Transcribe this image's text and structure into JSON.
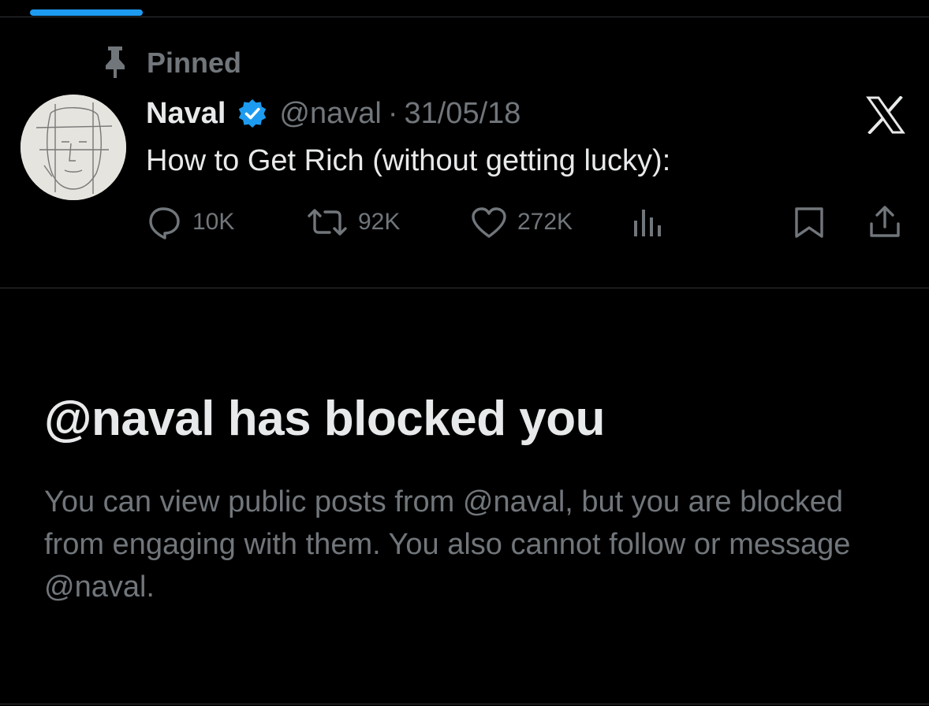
{
  "tabs": {
    "active_indicator_color": "#1d9bf0"
  },
  "pinned": {
    "label": "Pinned",
    "icon": "pin-icon"
  },
  "tweet": {
    "author_name": "Naval",
    "verified_icon": "verified-badge-icon",
    "handle": "@naval",
    "separator": "·",
    "date": "31/05/18",
    "text": "How to Get Rich (without getting lucky):",
    "platform_icon": "x-logo-icon",
    "actions": {
      "replies": {
        "icon": "reply-icon",
        "count": "10K"
      },
      "reposts": {
        "icon": "repost-icon",
        "count": "92K"
      },
      "likes": {
        "icon": "heart-icon",
        "count": "272K"
      },
      "views": {
        "icon": "analytics-icon"
      },
      "bookmark": {
        "icon": "bookmark-icon"
      },
      "share": {
        "icon": "share-icon"
      }
    }
  },
  "blocked": {
    "title": "@naval has blocked you",
    "description": "You can view public posts from @naval, but you are blocked from engaging with them. You also cannot follow or message @naval."
  },
  "colors": {
    "background": "#000000",
    "primary_text": "#e7e9ea",
    "secondary_text": "#71767b",
    "accent": "#1d9bf0",
    "divider": "#2f3336"
  }
}
